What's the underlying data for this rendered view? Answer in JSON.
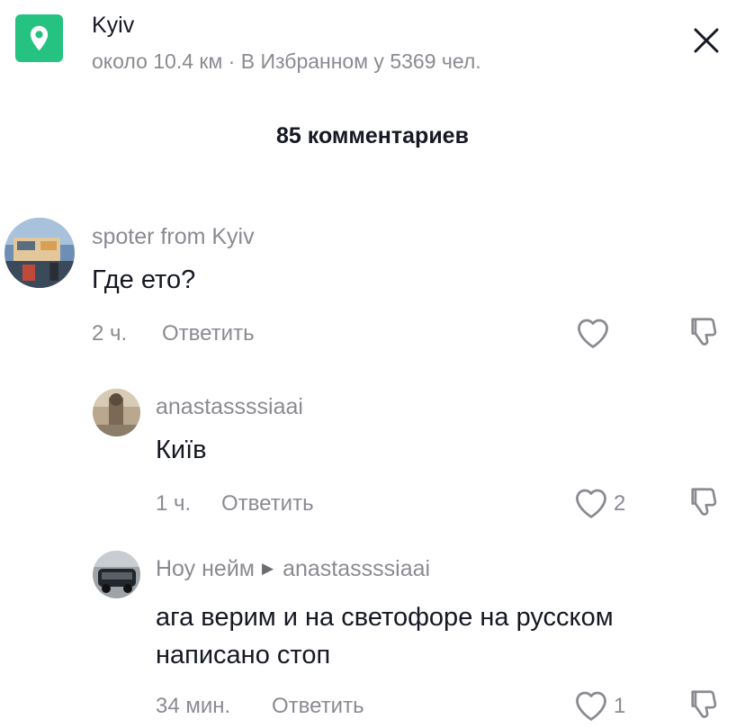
{
  "header": {
    "location_title": "Kyiv",
    "location_subtitle": "около 10.4 км · В Избранном у 5369 чел.",
    "icon": "map-pin-icon",
    "accent": "#25c281"
  },
  "comments_title": "85 комментариев",
  "comments": [
    {
      "username": "spoter from Kyiv",
      "text": "Где ето?",
      "time": "2 ч.",
      "reply_label": "Ответить",
      "likes": ""
    },
    {
      "username": "anastassssiaai",
      "text": "Київ",
      "time": "1 ч.",
      "reply_label": "Ответить",
      "likes": "2"
    },
    {
      "username": "Ноу нейм",
      "reply_to": "anastassssiaai",
      "text_line1": "ага верим и на светофоре на русском",
      "text_line2": "написано стоп",
      "time": "34 мин.",
      "reply_label": "Ответить",
      "likes": "1"
    }
  ]
}
